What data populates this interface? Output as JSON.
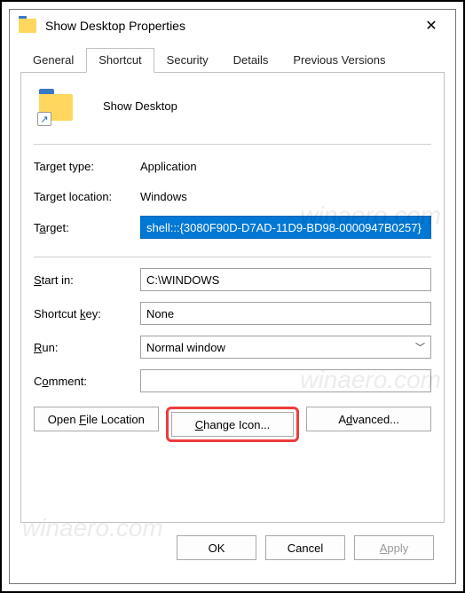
{
  "window": {
    "title": "Show Desktop Properties",
    "close_symbol": "✕"
  },
  "tabs": {
    "general": "General",
    "shortcut": "Shortcut",
    "security": "Security",
    "details": "Details",
    "previous": "Previous Versions"
  },
  "header": {
    "name": "Show Desktop",
    "arrow": "↗"
  },
  "fields": {
    "target_type": {
      "label": "Target type:",
      "value": "Application"
    },
    "target_location": {
      "label": "Target location:",
      "value": "Windows"
    },
    "target": {
      "label_pre": "T",
      "label_u": "a",
      "label_post": "rget:",
      "value": "shell:::{3080F90D-D7AD-11D9-BD98-0000947B0257}"
    },
    "start_in": {
      "label_pre": "",
      "label_u": "S",
      "label_post": "tart in:",
      "value": "C:\\WINDOWS"
    },
    "shortcut_key": {
      "label_pre": "Shortcut ",
      "label_u": "k",
      "label_post": "ey:",
      "value": "None"
    },
    "run": {
      "label_pre": "",
      "label_u": "R",
      "label_post": "un:",
      "value": "Normal window"
    },
    "comment": {
      "label_pre": "C",
      "label_u": "o",
      "label_post": "mment:",
      "value": ""
    }
  },
  "buttons": {
    "open_location_pre": "Open ",
    "open_location_u": "F",
    "open_location_post": "ile Location",
    "change_icon_pre": "",
    "change_icon_u": "C",
    "change_icon_post": "hange Icon...",
    "advanced_pre": "A",
    "advanced_u": "d",
    "advanced_post": "vanced..."
  },
  "bottom": {
    "ok": "OK",
    "cancel": "Cancel",
    "apply_pre": "",
    "apply_u": "A",
    "apply_post": "pply"
  },
  "watermark": "winaero.com"
}
